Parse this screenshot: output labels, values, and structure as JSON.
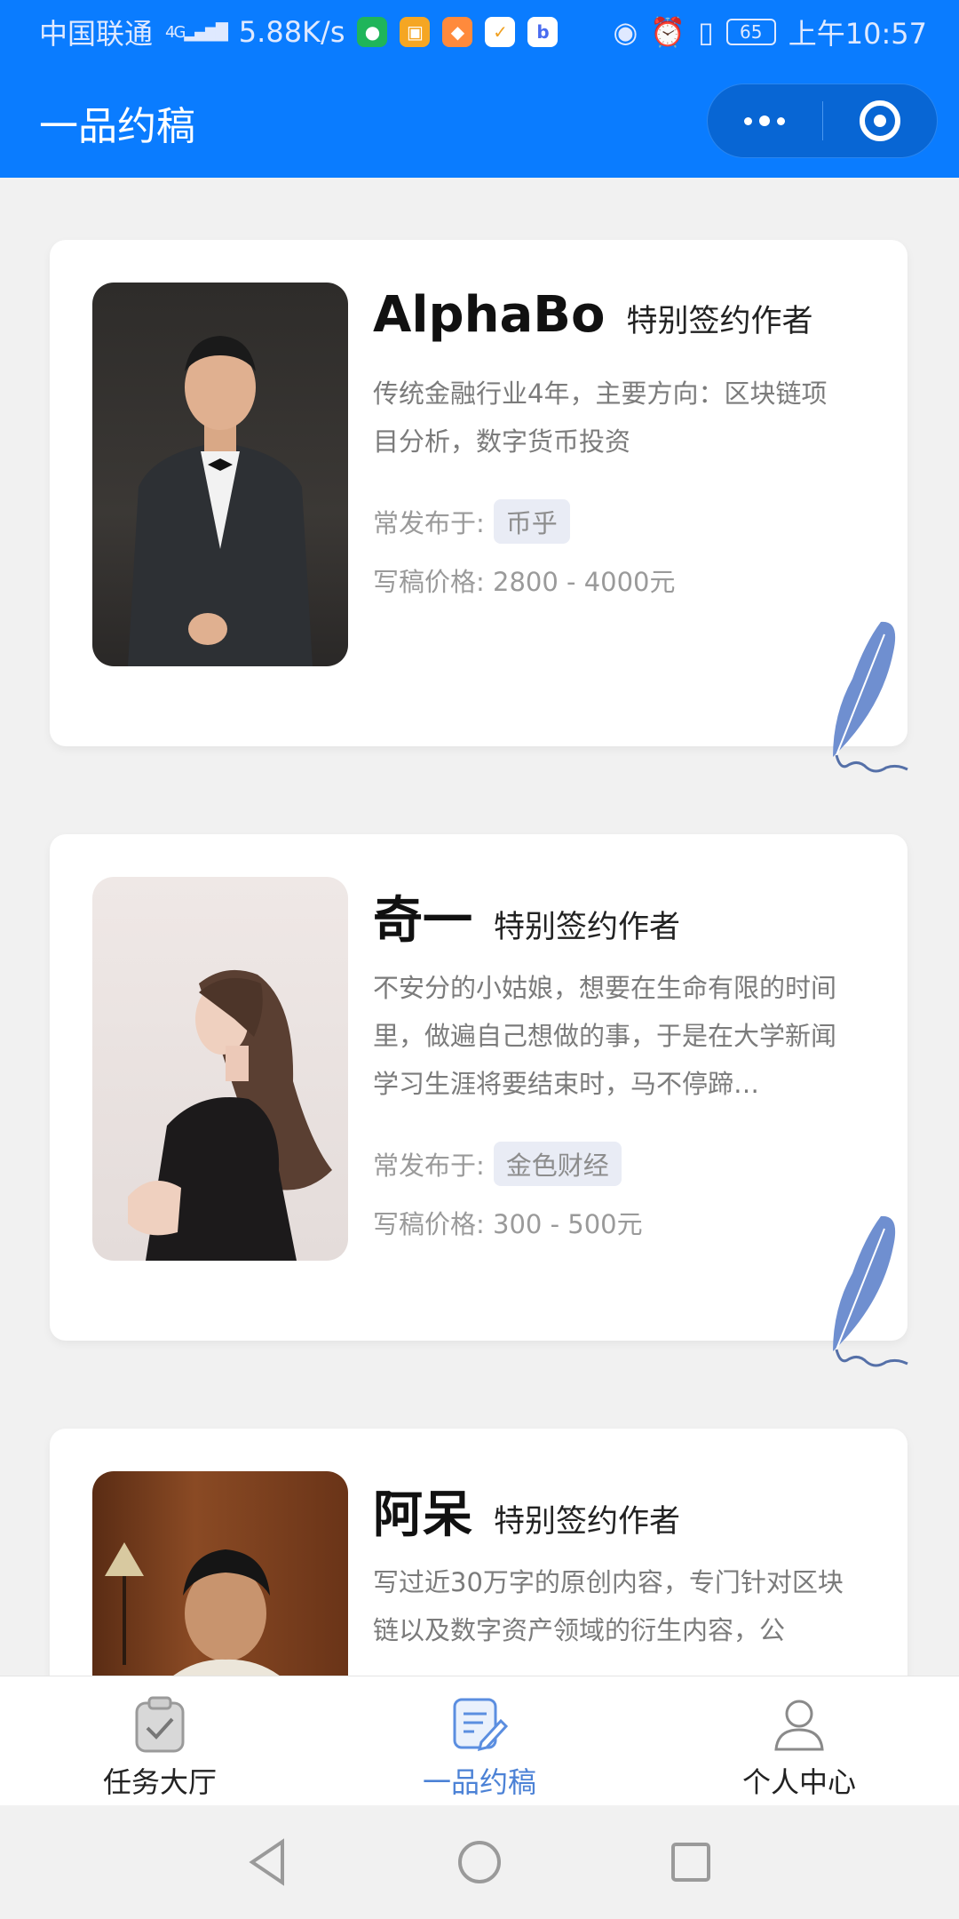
{
  "status_bar": {
    "carrier": "中国联通",
    "network": "4G",
    "speed": "5.88K/s",
    "battery": "65",
    "time": "上午10:57"
  },
  "header": {
    "title": "一品约稿"
  },
  "authors": [
    {
      "name": "AlphaBo",
      "tagline": "特别签约作者",
      "description": "传统金融行业4年，主要方向：区块链项目分析，数字货币投资",
      "published_label": "常发布于:",
      "platform": "币乎",
      "price_label": "写稿价格:",
      "price": "2800 - 4000元"
    },
    {
      "name": "奇一",
      "tagline": "特别签约作者",
      "description": "不安分的小姑娘，想要在生命有限的时间里，做遍自己想做的事，于是在大学新闻学习生涯将要结束时，马不停蹄…",
      "published_label": "常发布于:",
      "platform": "金色财经",
      "price_label": "写稿价格:",
      "price": "300 - 500元"
    },
    {
      "name": "阿呆",
      "tagline": "特别签约作者",
      "description": "写过近30万字的原创内容，专门针对区块链以及数字资产领域的衍生内容，公"
    }
  ],
  "tabs": [
    {
      "label": "任务大厅",
      "icon": "clipboard-check-icon"
    },
    {
      "label": "一品约稿",
      "icon": "document-edit-icon",
      "active": true
    },
    {
      "label": "个人中心",
      "icon": "user-icon"
    }
  ],
  "colors": {
    "primary": "#0a7cff",
    "tab_active": "#4c82d6",
    "tag_bg": "#e9ecf5"
  }
}
